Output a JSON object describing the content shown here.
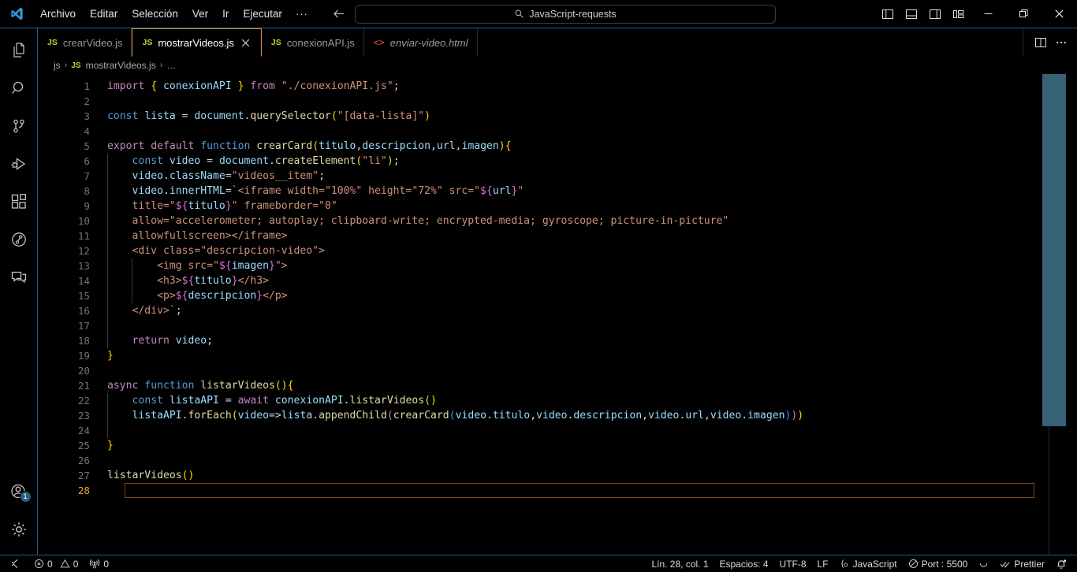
{
  "window": {
    "logo": "vscode-logo",
    "menu": [
      "Archivo",
      "Editar",
      "Selección",
      "Ver",
      "Ir",
      "Ejecutar"
    ],
    "menu_more": "···",
    "command_center_text": "JavaScript-requests",
    "nav_back": "back-arrow-icon",
    "nav_forward": "forward-arrow-icon",
    "layout_buttons": [
      "toggle-primary-sidebar",
      "toggle-panel",
      "toggle-secondary-sidebar",
      "customize-layout"
    ],
    "controls": {
      "minimize": "—",
      "restore": "restore-icon",
      "close": "✕"
    }
  },
  "activitybar": {
    "top": [
      {
        "name": "explorer",
        "icon": "files-icon"
      },
      {
        "name": "search",
        "icon": "search-icon"
      },
      {
        "name": "source-control",
        "icon": "source-control-icon"
      },
      {
        "name": "run-and-debug",
        "icon": "run-debug-icon"
      },
      {
        "name": "extensions",
        "icon": "extensions-icon"
      },
      {
        "name": "live-share",
        "icon": "live-share-icon"
      },
      {
        "name": "comments",
        "icon": "comments-icon"
      }
    ],
    "bottom": [
      {
        "name": "accounts",
        "icon": "account-icon",
        "badge": "1"
      },
      {
        "name": "manage",
        "icon": "gear-icon",
        "badge": ""
      }
    ]
  },
  "tabs": [
    {
      "label": "crearVideo.js",
      "badge": "JS",
      "kind": "js",
      "active": false,
      "preview": false,
      "closable": false
    },
    {
      "label": "mostrarVideos.js",
      "badge": "JS",
      "kind": "js",
      "active": true,
      "preview": false,
      "closable": true
    },
    {
      "label": "conexionAPI.js",
      "badge": "JS",
      "kind": "js",
      "active": false,
      "preview": false,
      "closable": false
    },
    {
      "label": "enviar-video.html",
      "badge": "<>",
      "kind": "html",
      "active": false,
      "preview": true,
      "closable": false
    }
  ],
  "tabbar_actions": [
    "split-editor-right-icon",
    "more-actions-icon"
  ],
  "breadcrumbs": [
    {
      "text": "js",
      "badge": ""
    },
    {
      "text": "mostrarVideos.js",
      "badge": "JS"
    },
    {
      "text": "…",
      "badge": ""
    }
  ],
  "editor": {
    "current_line": 28,
    "total_lines": 28,
    "code": [
      {
        "n": 1,
        "indent": 0,
        "tokens": [
          {
            "t": "import",
            "c": "t-key"
          },
          {
            "t": " ",
            "c": "t-punc"
          },
          {
            "t": "{",
            "c": "t-br1"
          },
          {
            "t": " ",
            "c": "t-punc"
          },
          {
            "t": "conexionAPI",
            "c": "t-var"
          },
          {
            "t": " ",
            "c": "t-punc"
          },
          {
            "t": "}",
            "c": "t-br1"
          },
          {
            "t": " ",
            "c": "t-punc"
          },
          {
            "t": "from",
            "c": "t-key"
          },
          {
            "t": " ",
            "c": "t-punc"
          },
          {
            "t": "\"./conexionAPI.js\"",
            "c": "t-str"
          },
          {
            "t": ";",
            "c": "t-punc"
          }
        ]
      },
      {
        "n": 2,
        "indent": 0,
        "tokens": []
      },
      {
        "n": 3,
        "indent": 0,
        "tokens": [
          {
            "t": "const",
            "c": "t-ctl"
          },
          {
            "t": " ",
            "c": "t-punc"
          },
          {
            "t": "lista",
            "c": "t-var"
          },
          {
            "t": " = ",
            "c": "t-punc"
          },
          {
            "t": "document",
            "c": "t-var"
          },
          {
            "t": ".",
            "c": "t-punc"
          },
          {
            "t": "querySelector",
            "c": "t-fn"
          },
          {
            "t": "(",
            "c": "t-br1"
          },
          {
            "t": "\"[data-lista]\"",
            "c": "t-str"
          },
          {
            "t": ")",
            "c": "t-br1"
          }
        ]
      },
      {
        "n": 4,
        "indent": 0,
        "tokens": []
      },
      {
        "n": 5,
        "indent": 0,
        "tokens": [
          {
            "t": "export",
            "c": "t-key"
          },
          {
            "t": " ",
            "c": "t-punc"
          },
          {
            "t": "default",
            "c": "t-key"
          },
          {
            "t": " ",
            "c": "t-punc"
          },
          {
            "t": "function",
            "c": "t-ctl"
          },
          {
            "t": " ",
            "c": "t-punc"
          },
          {
            "t": "crearCard",
            "c": "t-fn"
          },
          {
            "t": "(",
            "c": "t-br1"
          },
          {
            "t": "titulo",
            "c": "t-var"
          },
          {
            "t": ",",
            "c": "t-punc"
          },
          {
            "t": "descripcion",
            "c": "t-var"
          },
          {
            "t": ",",
            "c": "t-punc"
          },
          {
            "t": "url",
            "c": "t-var"
          },
          {
            "t": ",",
            "c": "t-punc"
          },
          {
            "t": "imagen",
            "c": "t-var"
          },
          {
            "t": ")",
            "c": "t-br1"
          },
          {
            "t": "{",
            "c": "t-br1"
          }
        ]
      },
      {
        "n": 6,
        "indent": 1,
        "tokens": [
          {
            "t": "    ",
            "c": "t-punc"
          },
          {
            "t": "const",
            "c": "t-ctl"
          },
          {
            "t": " ",
            "c": "t-punc"
          },
          {
            "t": "video",
            "c": "t-var"
          },
          {
            "t": " = ",
            "c": "t-punc"
          },
          {
            "t": "document",
            "c": "t-var"
          },
          {
            "t": ".",
            "c": "t-punc"
          },
          {
            "t": "createElement",
            "c": "t-fn"
          },
          {
            "t": "(",
            "c": "t-br1"
          },
          {
            "t": "\"li\"",
            "c": "t-str"
          },
          {
            "t": ")",
            "c": "t-br1"
          },
          {
            "t": ";",
            "c": "t-punc"
          }
        ]
      },
      {
        "n": 7,
        "indent": 1,
        "tokens": [
          {
            "t": "    ",
            "c": "t-punc"
          },
          {
            "t": "video",
            "c": "t-var"
          },
          {
            "t": ".",
            "c": "t-punc"
          },
          {
            "t": "className",
            "c": "t-prop"
          },
          {
            "t": "=",
            "c": "t-punc"
          },
          {
            "t": "\"videos__item\"",
            "c": "t-str"
          },
          {
            "t": ";",
            "c": "t-punc"
          }
        ]
      },
      {
        "n": 8,
        "indent": 1,
        "tokens": [
          {
            "t": "    ",
            "c": "t-punc"
          },
          {
            "t": "video",
            "c": "t-var"
          },
          {
            "t": ".",
            "c": "t-punc"
          },
          {
            "t": "innerHTML",
            "c": "t-prop"
          },
          {
            "t": "=",
            "c": "t-punc"
          },
          {
            "t": "`<iframe width=\"100%\" height=\"72%\" src=\"",
            "c": "t-tpl"
          },
          {
            "t": "${",
            "c": "t-br2"
          },
          {
            "t": "url",
            "c": "t-var"
          },
          {
            "t": "}",
            "c": "t-br2"
          },
          {
            "t": "\"",
            "c": "t-tpl"
          }
        ]
      },
      {
        "n": 9,
        "indent": 1,
        "tokens": [
          {
            "t": "    ",
            "c": "t-punc"
          },
          {
            "t": "title=\"",
            "c": "t-tpl"
          },
          {
            "t": "${",
            "c": "t-br2"
          },
          {
            "t": "titulo",
            "c": "t-var"
          },
          {
            "t": "}",
            "c": "t-br2"
          },
          {
            "t": "\" frameborder=\"0\"",
            "c": "t-tpl"
          }
        ]
      },
      {
        "n": 10,
        "indent": 1,
        "tokens": [
          {
            "t": "    allow=\"accelerometer; autoplay; clipboard-write; encrypted-media; gyroscope; picture-in-picture\"",
            "c": "t-tpl"
          }
        ]
      },
      {
        "n": 11,
        "indent": 1,
        "tokens": [
          {
            "t": "    allowfullscreen></iframe>",
            "c": "t-tpl"
          }
        ]
      },
      {
        "n": 12,
        "indent": 1,
        "tokens": [
          {
            "t": "    <div class=\"descripcion-video\">",
            "c": "t-tpl"
          }
        ]
      },
      {
        "n": 13,
        "indent": 2,
        "tokens": [
          {
            "t": "        <img src=\"",
            "c": "t-tpl"
          },
          {
            "t": "${",
            "c": "t-br2"
          },
          {
            "t": "imagen",
            "c": "t-var"
          },
          {
            "t": "}",
            "c": "t-br2"
          },
          {
            "t": "\">",
            "c": "t-tpl"
          }
        ]
      },
      {
        "n": 14,
        "indent": 2,
        "tokens": [
          {
            "t": "        <h3>",
            "c": "t-tpl"
          },
          {
            "t": "${",
            "c": "t-br2"
          },
          {
            "t": "titulo",
            "c": "t-var"
          },
          {
            "t": "}",
            "c": "t-br2"
          },
          {
            "t": "</h3>",
            "c": "t-tpl"
          }
        ]
      },
      {
        "n": 15,
        "indent": 2,
        "tokens": [
          {
            "t": "        <p>",
            "c": "t-tpl"
          },
          {
            "t": "${",
            "c": "t-br2"
          },
          {
            "t": "descripcion",
            "c": "t-var"
          },
          {
            "t": "}",
            "c": "t-br2"
          },
          {
            "t": "</p>",
            "c": "t-tpl"
          }
        ]
      },
      {
        "n": 16,
        "indent": 1,
        "tokens": [
          {
            "t": "    </div>`",
            "c": "t-tpl"
          },
          {
            "t": ";",
            "c": "t-punc"
          }
        ]
      },
      {
        "n": 17,
        "indent": 1,
        "tokens": []
      },
      {
        "n": 18,
        "indent": 1,
        "tokens": [
          {
            "t": "    ",
            "c": "t-punc"
          },
          {
            "t": "return",
            "c": "t-key"
          },
          {
            "t": " ",
            "c": "t-punc"
          },
          {
            "t": "video",
            "c": "t-var"
          },
          {
            "t": ";",
            "c": "t-punc"
          }
        ]
      },
      {
        "n": 19,
        "indent": 0,
        "tokens": [
          {
            "t": "}",
            "c": "t-br1"
          }
        ]
      },
      {
        "n": 20,
        "indent": 0,
        "tokens": []
      },
      {
        "n": 21,
        "indent": 0,
        "tokens": [
          {
            "t": "async",
            "c": "t-key"
          },
          {
            "t": " ",
            "c": "t-punc"
          },
          {
            "t": "function",
            "c": "t-ctl"
          },
          {
            "t": " ",
            "c": "t-punc"
          },
          {
            "t": "listarVideos",
            "c": "t-fn"
          },
          {
            "t": "(",
            "c": "t-br1"
          },
          {
            "t": ")",
            "c": "t-br1"
          },
          {
            "t": "{",
            "c": "t-br1"
          }
        ]
      },
      {
        "n": 22,
        "indent": 1,
        "tokens": [
          {
            "t": "    ",
            "c": "t-punc"
          },
          {
            "t": "const",
            "c": "t-ctl"
          },
          {
            "t": " ",
            "c": "t-punc"
          },
          {
            "t": "listaAPI",
            "c": "t-var"
          },
          {
            "t": " = ",
            "c": "t-punc"
          },
          {
            "t": "await",
            "c": "t-key"
          },
          {
            "t": " ",
            "c": "t-punc"
          },
          {
            "t": "conexionAPI",
            "c": "t-var"
          },
          {
            "t": ".",
            "c": "t-punc"
          },
          {
            "t": "listarVideos",
            "c": "t-fn"
          },
          {
            "t": "(",
            "c": "t-br1"
          },
          {
            "t": ")",
            "c": "t-br1"
          }
        ]
      },
      {
        "n": 23,
        "indent": 1,
        "tokens": [
          {
            "t": "    ",
            "c": "t-punc"
          },
          {
            "t": "listaAPI",
            "c": "t-var"
          },
          {
            "t": ".",
            "c": "t-punc"
          },
          {
            "t": "forEach",
            "c": "t-fn"
          },
          {
            "t": "(",
            "c": "t-br1"
          },
          {
            "t": "video",
            "c": "t-var"
          },
          {
            "t": "=>",
            "c": "t-punc"
          },
          {
            "t": "lista",
            "c": "t-var"
          },
          {
            "t": ".",
            "c": "t-punc"
          },
          {
            "t": "appendChild",
            "c": "t-fn"
          },
          {
            "t": "(",
            "c": "t-br2"
          },
          {
            "t": "crearCard",
            "c": "t-fn"
          },
          {
            "t": "(",
            "c": "t-br3"
          },
          {
            "t": "video",
            "c": "t-var"
          },
          {
            "t": ".",
            "c": "t-punc"
          },
          {
            "t": "titulo",
            "c": "t-prop"
          },
          {
            "t": ",",
            "c": "t-punc"
          },
          {
            "t": "video",
            "c": "t-var"
          },
          {
            "t": ".",
            "c": "t-punc"
          },
          {
            "t": "descripcion",
            "c": "t-prop"
          },
          {
            "t": ",",
            "c": "t-punc"
          },
          {
            "t": "video",
            "c": "t-var"
          },
          {
            "t": ".",
            "c": "t-punc"
          },
          {
            "t": "url",
            "c": "t-prop"
          },
          {
            "t": ",",
            "c": "t-punc"
          },
          {
            "t": "video",
            "c": "t-var"
          },
          {
            "t": ".",
            "c": "t-punc"
          },
          {
            "t": "imagen",
            "c": "t-prop"
          },
          {
            "t": ")",
            "c": "t-br3"
          },
          {
            "t": ")",
            "c": "t-br2"
          },
          {
            "t": ")",
            "c": "t-br1"
          }
        ]
      },
      {
        "n": 24,
        "indent": 1,
        "tokens": []
      },
      {
        "n": 25,
        "indent": 0,
        "tokens": [
          {
            "t": "}",
            "c": "t-br1"
          }
        ]
      },
      {
        "n": 26,
        "indent": 0,
        "tokens": []
      },
      {
        "n": 27,
        "indent": 0,
        "tokens": [
          {
            "t": "listarVideos",
            "c": "t-fn"
          },
          {
            "t": "(",
            "c": "t-br1"
          },
          {
            "t": ")",
            "c": "t-br1"
          }
        ]
      },
      {
        "n": 28,
        "indent": 0,
        "tokens": []
      }
    ]
  },
  "statusbar": {
    "remote_icon": "remote-window-icon",
    "errors": "0",
    "warnings": "0",
    "ports": "0",
    "cursor_position": "Lín. 28, col. 1",
    "indentation": "Espacios: 4",
    "encoding": "UTF-8",
    "eol": "LF",
    "language": "JavaScript",
    "port": "Port : 5500",
    "formatter": "Prettier",
    "notifications_icon": "bell-icon",
    "spinner_icon": "loading-spinner-icon"
  },
  "colors": {
    "accent_border": "#1b5e8c",
    "active_tab_border": "#e08a3c",
    "background": "#000000",
    "minimap_slider": "#3f7389",
    "current_line_border": "#7a4a1e",
    "js_badge": "#cbcb41",
    "html_badge": "#e8623a",
    "badge_bg": "#2a5f7a"
  }
}
